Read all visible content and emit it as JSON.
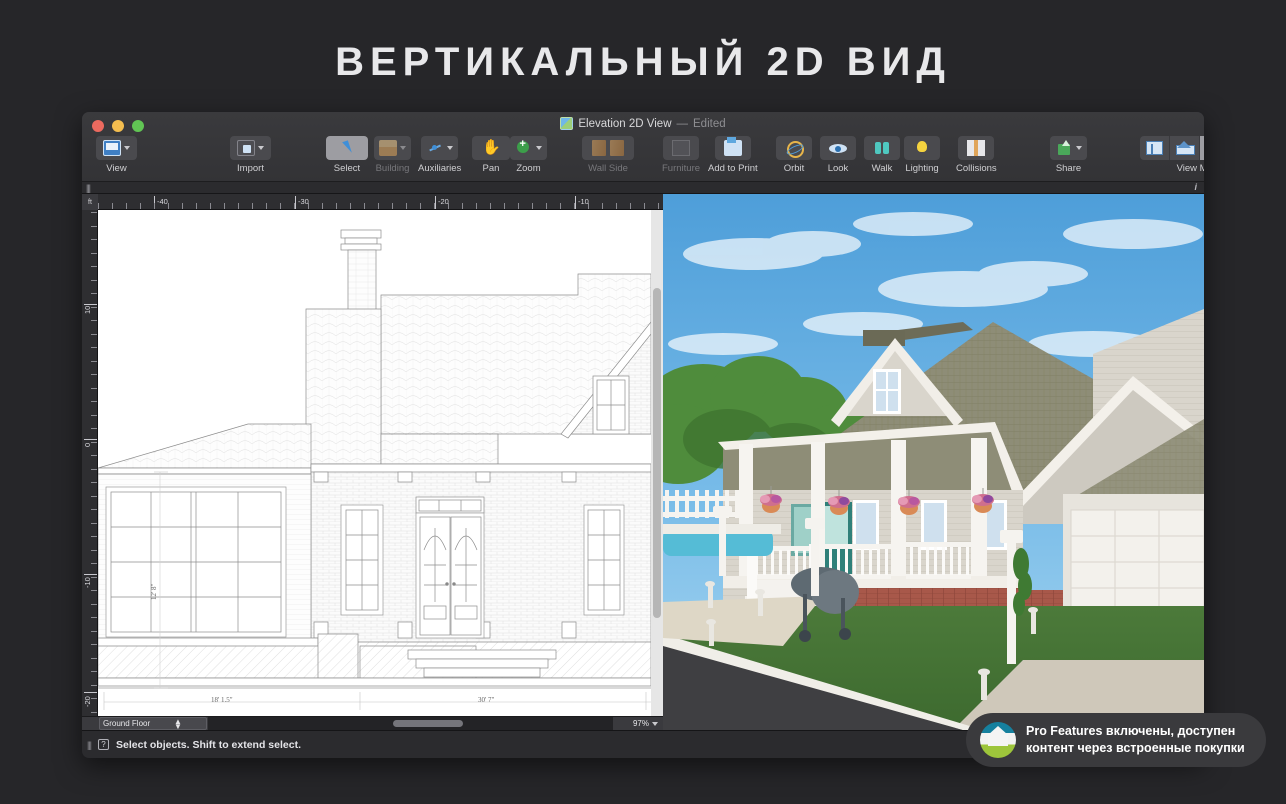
{
  "headline": "ВЕРТИКАЛЬНЫЙ 2D ВИД",
  "window": {
    "title": "Elevation 2D View",
    "title_separator": "—",
    "title_state": "Edited",
    "traffic_lights": [
      "close-red",
      "minimize-yellow",
      "zoom-green"
    ]
  },
  "toolbar": {
    "groups": [
      {
        "label": "View",
        "icon": "view-icon",
        "dropdown": true,
        "state": "normal"
      },
      {
        "label": "Import",
        "icon": "import-icon",
        "dropdown": true,
        "state": "normal"
      },
      {
        "label": "Select",
        "icon": "cursor-icon",
        "dropdown": false,
        "state": "active"
      },
      {
        "label": "Building",
        "icon": "building-icon",
        "dropdown": true,
        "state": "disabled"
      },
      {
        "label": "Auxiliaries",
        "icon": "auxiliaries-icon",
        "dropdown": true,
        "state": "normal"
      },
      {
        "label": "Pan",
        "icon": "hand-icon",
        "dropdown": false,
        "state": "normal"
      },
      {
        "label": "Zoom",
        "icon": "zoom-in-icon",
        "dropdown": true,
        "state": "normal"
      },
      {
        "label": "Wall Side",
        "icon": "wall-side-icon",
        "dropdown": false,
        "state": "disabled"
      },
      {
        "label": "Furniture",
        "icon": "furniture-icon",
        "dropdown": false,
        "state": "disabled"
      },
      {
        "label": "Add to Print",
        "icon": "print-icon",
        "dropdown": false,
        "state": "normal"
      },
      {
        "label": "Orbit",
        "icon": "orbit-icon",
        "dropdown": false,
        "state": "normal"
      },
      {
        "label": "Look",
        "icon": "eye-icon",
        "dropdown": false,
        "state": "normal"
      },
      {
        "label": "Walk",
        "icon": "walk-icon",
        "dropdown": false,
        "state": "normal"
      },
      {
        "label": "Lighting",
        "icon": "lightbulb-icon",
        "dropdown": false,
        "state": "normal"
      },
      {
        "label": "Collisions",
        "icon": "collisions-icon",
        "dropdown": false,
        "state": "normal"
      },
      {
        "label": "Share",
        "icon": "share-icon",
        "dropdown": true,
        "state": "normal"
      }
    ],
    "view_mode": {
      "label": "View Mode",
      "buttons": [
        {
          "icon": "floor-plan-icon",
          "active": false
        },
        {
          "icon": "elevation-icon",
          "active": false
        },
        {
          "icon": "isometric-icon",
          "active": true
        },
        {
          "icon": "solid-3d-icon",
          "active": false
        }
      ]
    }
  },
  "canvas": {
    "info_icon": "info-icon",
    "grip_icon": "drag-grip-icon",
    "ruler": {
      "unit": "ft",
      "horizontal_labels": [
        "-40",
        "-30",
        "-20",
        "-10"
      ],
      "vertical_labels": [
        "10",
        "0",
        "-10",
        "-20"
      ]
    },
    "dimensions": {
      "height": "12' 8\"",
      "width_left": "18' 1.5\"",
      "width_right": "30' 7\""
    }
  },
  "bottom_bar": {
    "floor_selector": "Ground Floor",
    "zoom_level": "97%",
    "zoom_chevron_icon": "chevron-down-icon",
    "stepper_icon": "stepper-updown-icon"
  },
  "status_bar": {
    "help_icon": "question-mark-icon",
    "grip_icon": "drag-grip-icon",
    "message": "Select objects. Shift to extend select."
  },
  "pro_badge": {
    "icon": "app-house-icon",
    "line1": "Pro Features включены, доступен",
    "line2": "контент через встроенные покупки"
  },
  "colors": {
    "page_background": "#262629",
    "window_chrome": "#3a3a3d",
    "accent_blue": "#3f8fd8",
    "sky": "#6fb3e4",
    "grass": "#3f6b33",
    "brick": "#a8594a"
  }
}
